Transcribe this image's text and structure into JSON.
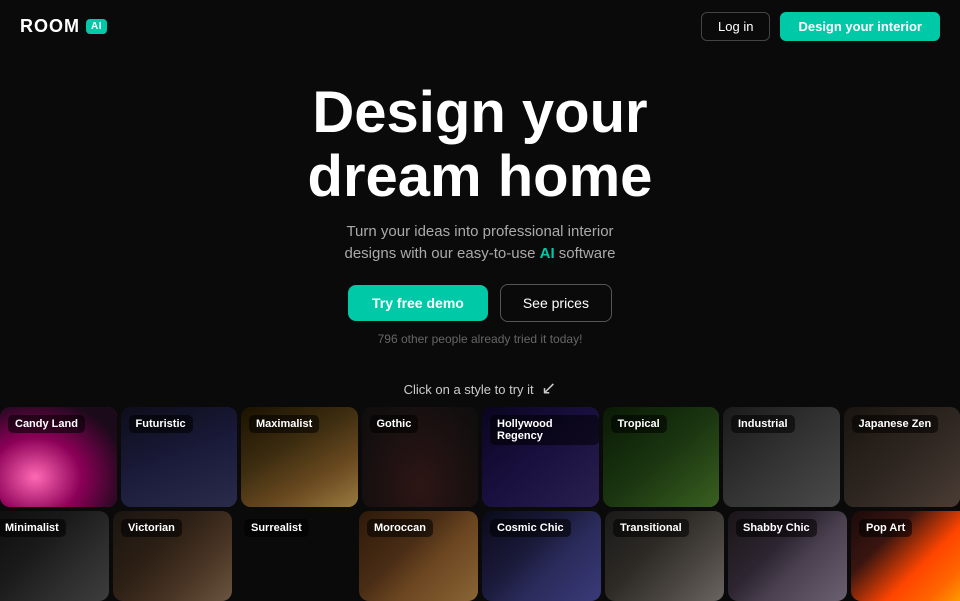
{
  "logo": {
    "text": "ROOM",
    "badge": "AI"
  },
  "nav": {
    "login_label": "Log in",
    "design_label": "Design your interior"
  },
  "hero": {
    "title_line1": "Design your",
    "title_line2": "dream home",
    "subtitle": "Turn your ideas into professional interior",
    "subtitle2": "designs with our easy-to-use",
    "ai_word": "AI",
    "subtitle3": "software",
    "btn_demo": "Try free demo",
    "btn_prices": "See prices",
    "social_proof": "796 other people already tried it today!"
  },
  "styles_hint": "Click on a style to try it",
  "row1": [
    {
      "label": "Candy Land",
      "class": "card-candy"
    },
    {
      "label": "Futuristic",
      "class": "card-futuristic"
    },
    {
      "label": "Maximalist",
      "class": "card-maximalist"
    },
    {
      "label": "Gothic",
      "class": "card-gothic"
    },
    {
      "label": "Hollywood Regency",
      "class": "card-hollywood"
    },
    {
      "label": "Tropical",
      "class": "card-tropical"
    },
    {
      "label": "Industrial",
      "class": "card-industrial"
    },
    {
      "label": "Japanese Zen",
      "class": "card-japanese"
    }
  ],
  "row2": [
    {
      "label": "Minimalist",
      "class": "card-minimalist"
    },
    {
      "label": "Victorian",
      "class": "card-victorian"
    },
    {
      "label": "Surrealist",
      "class": "card-surrealist"
    },
    {
      "label": "Moroccan",
      "class": "card-moroccan"
    },
    {
      "label": "Cosmic Chic",
      "class": "card-cosmic"
    },
    {
      "label": "Transitional",
      "class": "card-transitional"
    },
    {
      "label": "Shabby Chic",
      "class": "card-shabby"
    },
    {
      "label": "Pop Art",
      "class": "card-popart"
    }
  ]
}
